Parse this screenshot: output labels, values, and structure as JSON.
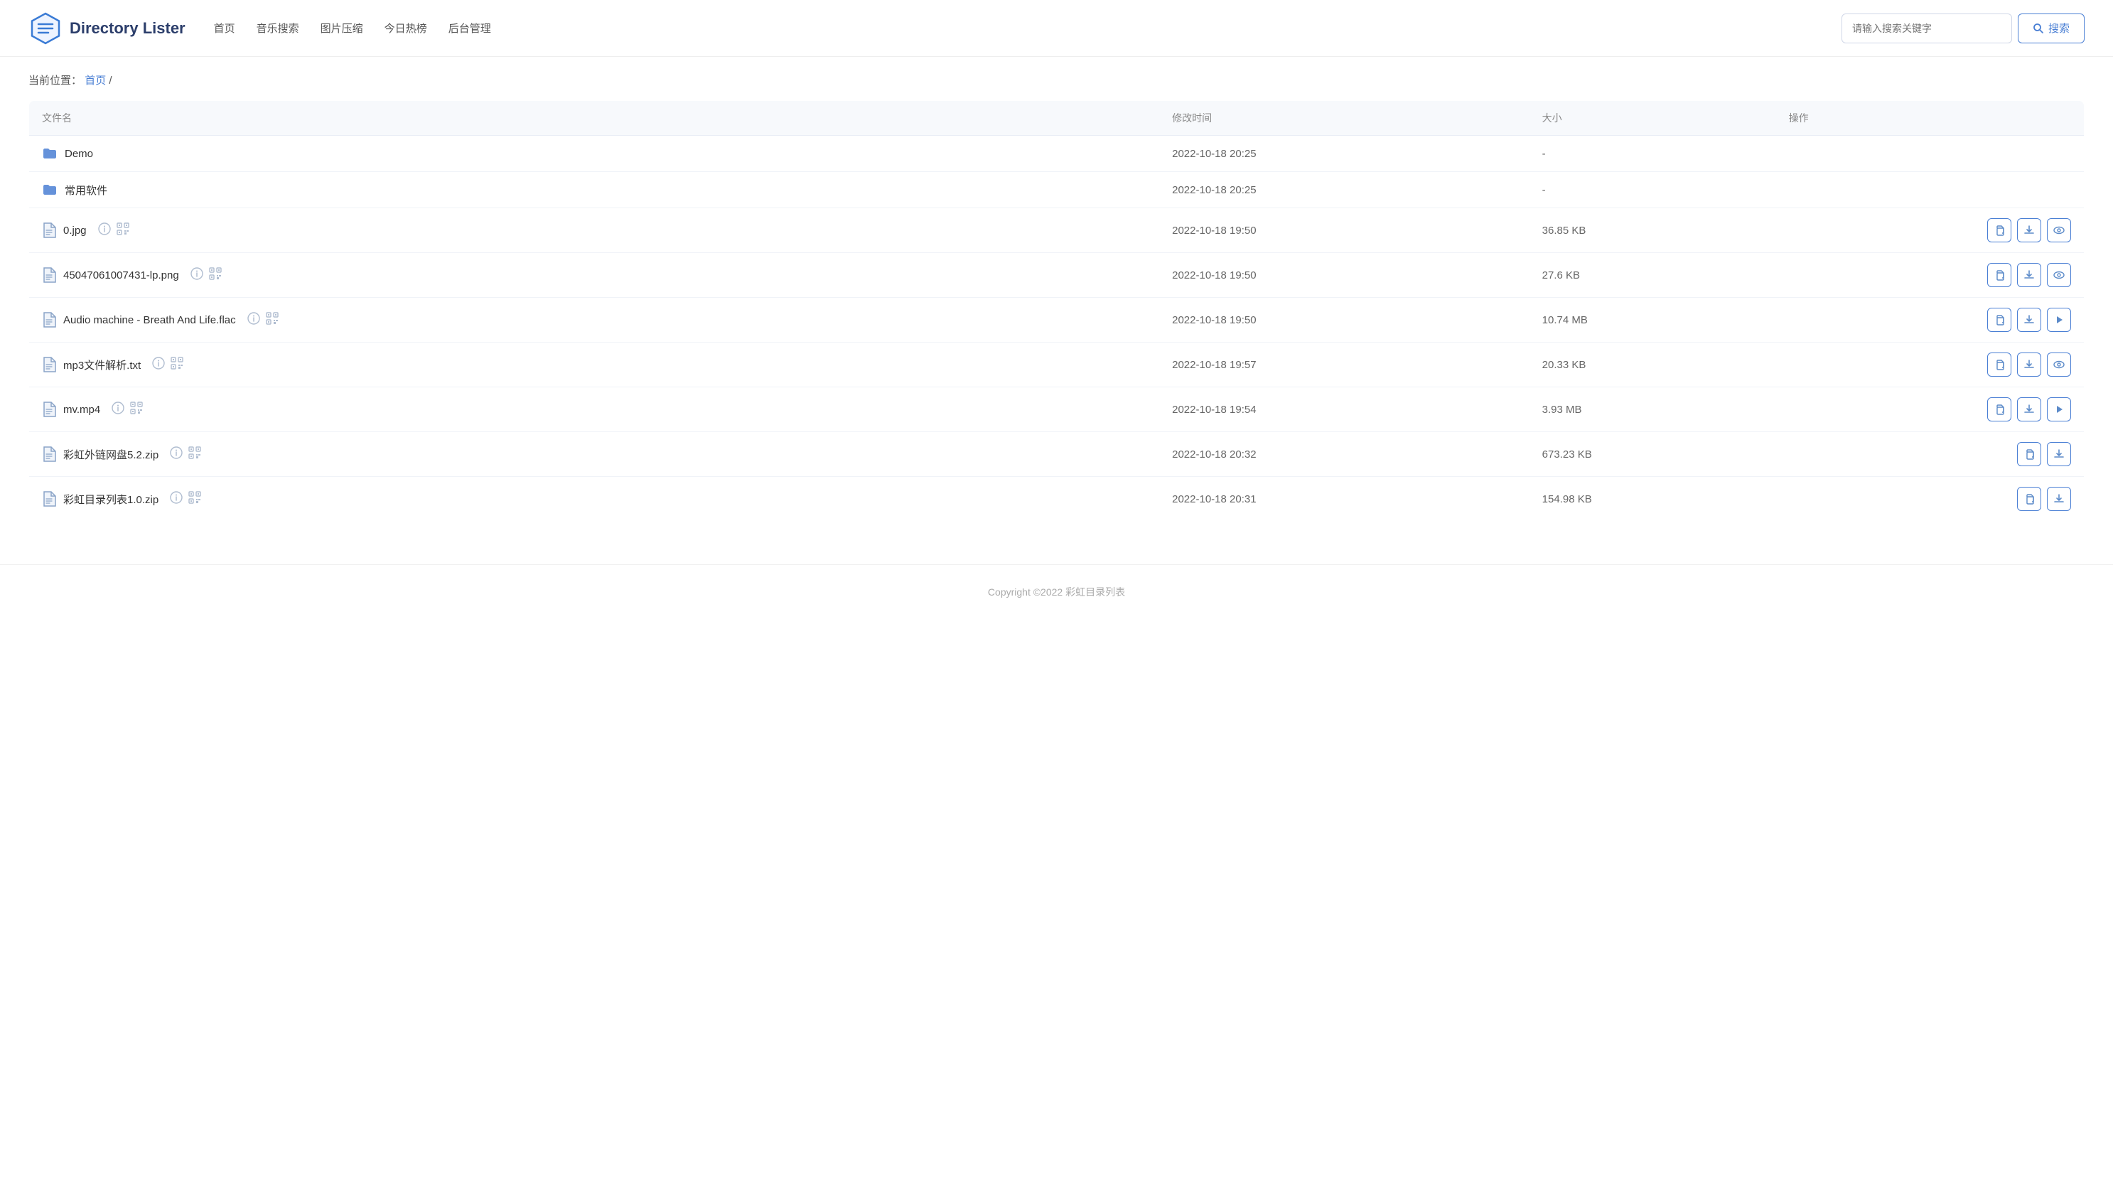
{
  "header": {
    "logo_text": "Directory Lister",
    "nav": [
      {
        "label": "首页",
        "id": "home"
      },
      {
        "label": "音乐搜索",
        "id": "music"
      },
      {
        "label": "图片压缩",
        "id": "image"
      },
      {
        "label": "今日热榜",
        "id": "hot"
      },
      {
        "label": "后台管理",
        "id": "admin"
      }
    ],
    "search_placeholder": "请输入搜索关键字",
    "search_btn": "搜索"
  },
  "breadcrumb": {
    "label": "当前位置：",
    "home_link": "首页",
    "separator": "/"
  },
  "table": {
    "headers": {
      "filename": "文件名",
      "modified": "修改时间",
      "size": "大小",
      "action": "操作"
    },
    "rows": [
      {
        "type": "folder",
        "name": "Demo",
        "modified": "2022-10-18 20:25",
        "size": "-",
        "has_info": false,
        "has_qr": false,
        "actions": []
      },
      {
        "type": "folder",
        "name": "常用软件",
        "modified": "2022-10-18 20:25",
        "size": "-",
        "has_info": false,
        "has_qr": false,
        "actions": []
      },
      {
        "type": "file",
        "name": "0.jpg",
        "modified": "2022-10-18 19:50",
        "size": "36.85 KB",
        "has_info": true,
        "has_qr": true,
        "actions": [
          "copy",
          "download",
          "eye"
        ]
      },
      {
        "type": "file",
        "name": "45047061007431-lp.png",
        "modified": "2022-10-18 19:50",
        "size": "27.6 KB",
        "has_info": true,
        "has_qr": true,
        "actions": [
          "copy",
          "download",
          "eye"
        ]
      },
      {
        "type": "file",
        "name": "Audio machine - Breath And Life.flac",
        "modified": "2022-10-18 19:50",
        "size": "10.74 MB",
        "has_info": true,
        "has_qr": true,
        "actions": [
          "copy",
          "download",
          "play"
        ]
      },
      {
        "type": "file",
        "name": "mp3文件解析.txt",
        "modified": "2022-10-18 19:57",
        "size": "20.33 KB",
        "has_info": true,
        "has_qr": true,
        "actions": [
          "copy",
          "download",
          "eye"
        ]
      },
      {
        "type": "file",
        "name": "mv.mp4",
        "modified": "2022-10-18 19:54",
        "size": "3.93 MB",
        "has_info": true,
        "has_qr": true,
        "actions": [
          "copy",
          "download",
          "play"
        ]
      },
      {
        "type": "file",
        "name": "彩虹外链网盘5.2.zip",
        "modified": "2022-10-18 20:32",
        "size": "673.23 KB",
        "has_info": true,
        "has_qr": true,
        "actions": [
          "copy",
          "download"
        ]
      },
      {
        "type": "file",
        "name": "彩虹目录列表1.0.zip",
        "modified": "2022-10-18 20:31",
        "size": "154.98 KB",
        "has_info": true,
        "has_qr": true,
        "actions": [
          "copy",
          "download"
        ]
      }
    ]
  },
  "footer": {
    "text": "Copyright ©2022 彩虹目录列表"
  }
}
